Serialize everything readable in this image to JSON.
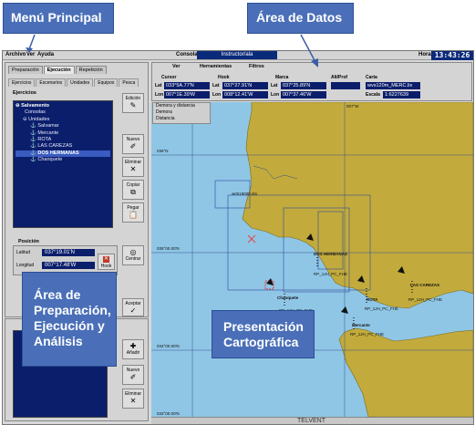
{
  "callouts": {
    "menu_principal": "Menú Principal",
    "area_datos": "Área de Datos",
    "area_prep_line1": "Área de",
    "area_prep_line2": "Preparación,",
    "area_prep_line3": "Ejecución y",
    "area_prep_line4": "Análisis",
    "presentacion_line1": "Presentación",
    "presentacion_line2": "Cartográfica"
  },
  "menubar": {
    "archivo": "Archivo",
    "ver": "Ver",
    "ayuda": "Ayuda",
    "consola_label": "Consola",
    "consola_value": "Instructor/ala",
    "hora_label": "Hora",
    "hora_value": "13:43:26"
  },
  "left_panel": {
    "tabs": [
      "Preparación",
      "Ejecución",
      "Repetición"
    ],
    "subtabs": [
      "Ejercicios",
      "Escenarios",
      "Unidades",
      "Equipos",
      "Pesca"
    ],
    "group_label": "Ejercicios",
    "tree": [
      "Salvamento",
      "Consolas",
      "Unidades",
      "Salvamar",
      "Mercante",
      "ROTA",
      "LAS CAREZAS",
      "DOS HERMANAS",
      "Chanquete"
    ],
    "buttons": {
      "edicion": "Edición",
      "nuevo": "Nuevo",
      "eliminar": "Eliminar",
      "copiar": "Copiar",
      "pegar": "Pegar",
      "centrar": "Centrar",
      "aceptar": "Aceptar"
    },
    "position": {
      "title": "Posición",
      "latitud_label": "Latitud",
      "latitud_value": "037°19.01'N",
      "longitud_label": "Longitud",
      "longitud_value": "007°17.48'W",
      "hook_label": "Hook"
    }
  },
  "lower_panel": {
    "buttons": {
      "nuevo": "Nuevo",
      "eliminar": "Eliminar",
      "add": "Añadir"
    }
  },
  "data_area": {
    "tabs": [
      "Ver",
      "Herramientas",
      "Filtros"
    ],
    "cursor_label": "Cursor",
    "hook_label": "Hook",
    "marca_label": "Marca",
    "altprof_label": "Alt/Prof",
    "carta_label": "Carta",
    "lat_label": "Lat",
    "lon_label": "Lon",
    "cursor_lat": "033°5A.77'N",
    "cursor_lon": "007°1E.39'W",
    "hook_lat": "037°27.91'N",
    "hook_lon": "008°12.41'W",
    "marca_lat": "037°25.89'N",
    "marca_lon": "007°37.46'W",
    "carta_value": "wvs120m_MERC.lix",
    "escala_label": "Escala",
    "escala_value": "1:6227639"
  },
  "map": {
    "dist_panel": [
      "Demora y distancia",
      "Demora",
      "Distancia"
    ],
    "lat_labels": [
      "036°N",
      "035°00.00'N",
      "034°00.00'N",
      "033°00.00'N"
    ],
    "lon_labels": [
      "008°W",
      "007°W"
    ],
    "area_label": "w0019000.dm",
    "units": [
      {
        "name": "Chanquete",
        "color": "#000000"
      },
      {
        "name": "DOS HERMANAS",
        "color": "#000000"
      },
      {
        "name": "ROTA",
        "color": "#000000"
      },
      {
        "name": "LAS CAREZAS",
        "color": "#000000"
      },
      {
        "name": "Mercante",
        "color": "#000000"
      }
    ],
    "track_labels": [
      "RP_1JH_PC_FHE",
      "RP_1JH_PC_FHE",
      "RP_1JH_PC_FHE",
      "RP_1JH_PC_FHE",
      "RP_1JH_PC_FHE"
    ],
    "colors": {
      "sea": "#8fc6e6",
      "land": "#c2ab3c",
      "grid": "#3a4f8a"
    }
  },
  "status": {
    "brand": "TELVENT"
  }
}
